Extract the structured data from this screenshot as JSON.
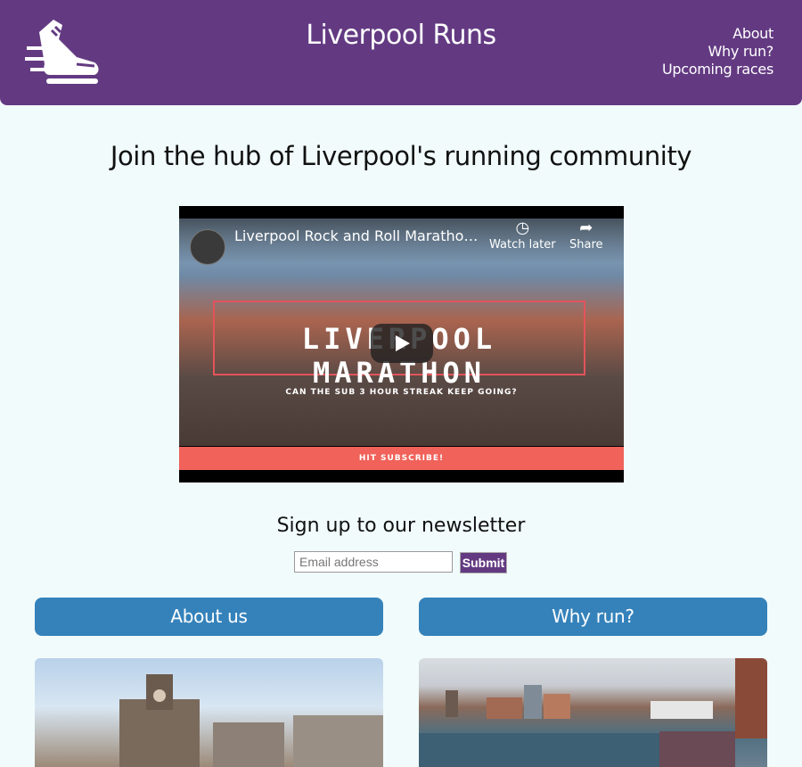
{
  "header": {
    "title": "Liverpool Runs",
    "nav": [
      "About",
      "Why run?",
      "Upcoming races"
    ]
  },
  "main": {
    "headline": "Join the hub of Liverpool's running community"
  },
  "video": {
    "title": "Liverpool Rock and Roll Maratho…",
    "watch_later": "Watch later",
    "share": "Share",
    "overlay_text": "LIVERPOOL MARATHON",
    "overlay_subtext": "CAN THE SUB 3 HOUR STREAK KEEP GOING?",
    "banner": "HIT SUBSCRIBE!"
  },
  "newsletter": {
    "heading": "Sign up to our newsletter",
    "placeholder": "Email address",
    "submit_label": "Submit"
  },
  "sections": {
    "about_label": "About us",
    "why_label": "Why run?"
  },
  "colors": {
    "header_bg": "#633a82",
    "page_bg": "#f1fbfb",
    "section_button": "#3582bb",
    "video_banner": "#f0625a"
  },
  "icons": {
    "logo": "running-shoe-icon",
    "watch_later": "clock-icon",
    "share": "share-arrow-icon",
    "play": "play-icon"
  }
}
